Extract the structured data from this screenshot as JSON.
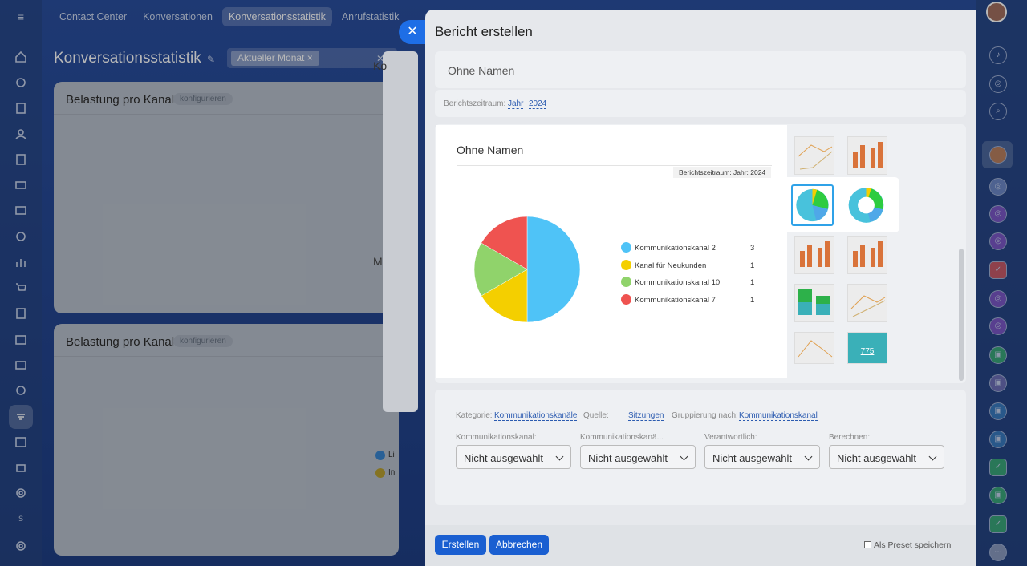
{
  "topnav": {
    "tabs": [
      {
        "label": "Contact Center",
        "active": false
      },
      {
        "label": "Konversationen",
        "active": false
      },
      {
        "label": "Konversationsstatistik",
        "active": true
      },
      {
        "label": "Anrufstatistik",
        "active": false
      }
    ]
  },
  "page": {
    "title": "Konversationsstatistik",
    "filter_chip": "Aktueller Monat"
  },
  "widgets": [
    {
      "title": "Belastung pro Kanal",
      "configure": "konfigurieren"
    },
    {
      "title": "Belastung pro Kanal",
      "configure": "konfigurieren"
    }
  ],
  "widget_legend": [
    "Li",
    "In"
  ],
  "left_badge": "S",
  "behind_panel": {
    "title_frag": "Ko",
    "sub_frag": "M"
  },
  "panel": {
    "title": "Bericht erstellen",
    "report_name": "Ohne Namen",
    "period_label": "Berichtszeitraum:",
    "period_type": "Jahr",
    "period_year": "2024"
  },
  "preview": {
    "title": "Ohne Namen",
    "period": "Berichtszeitraum: Jahr: 2024"
  },
  "chart_data": {
    "type": "pie",
    "title": "Ohne Namen",
    "categories": [
      "Kommunikationskanal 2",
      "Kanal für Neukunden",
      "Kommunikationskanal 10",
      "Kommunikationskanal 7"
    ],
    "values": [
      3,
      1,
      1,
      1
    ],
    "colors": [
      "#4fc3f7",
      "#f4cf00",
      "#90d36b",
      "#ef5350"
    ],
    "legend_position": "right"
  },
  "thumb_label": "775",
  "settings": {
    "category_label": "Kategorie:",
    "category_value": "Kommunikationskanäle",
    "source_label": "Quelle:",
    "source_value": "Sitzungen",
    "group_label": "Gruppierung nach:",
    "group_value": "Kommunikationskanal",
    "fields": [
      {
        "label": "Kommunikationskanal:",
        "value": "Nicht ausgewählt"
      },
      {
        "label": "Kommunikationskanä...",
        "value": "Nicht ausgewählt"
      },
      {
        "label": "Verantwortlich:",
        "value": "Nicht ausgewählt"
      },
      {
        "label": "Berechnen:",
        "value": "Nicht ausgewählt"
      }
    ]
  },
  "footer": {
    "create": "Erstellen",
    "cancel": "Abbrechen",
    "preset": "Als Preset speichern"
  }
}
